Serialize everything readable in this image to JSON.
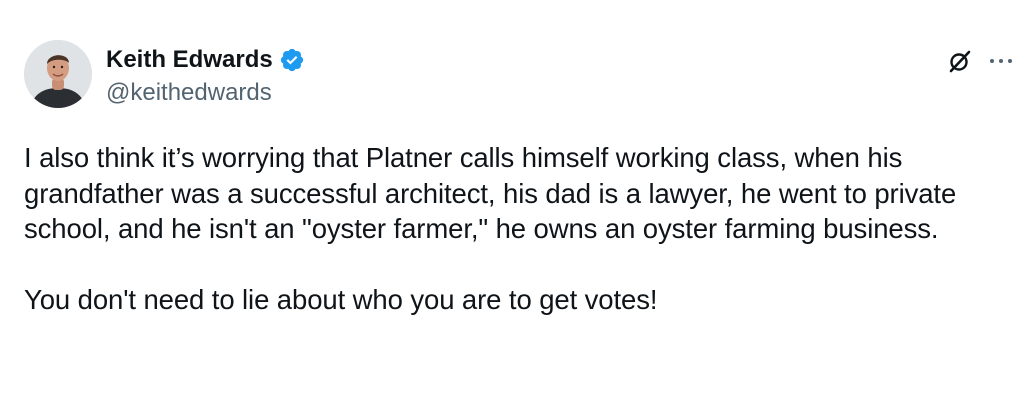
{
  "author": {
    "display_name": "Keith Edwards",
    "handle": "@keithedwards",
    "verified": true,
    "avatar": "profile-photo"
  },
  "actions": {
    "grok_icon": "grok-icon",
    "more_icon": "more-options-icon"
  },
  "post": {
    "paragraph_1": "I also think it’s worrying that Platner calls himself working class, when his grandfather was a successful architect, his dad is a lawyer, he went to private school, and he isn't an \"oyster farmer,\" he owns an oyster farming business.",
    "paragraph_2": "You don't need to lie about who you are to get votes!"
  },
  "colors": {
    "text": "#0f1419",
    "secondary": "#536471",
    "verified_blue": "#1d9bf0"
  }
}
